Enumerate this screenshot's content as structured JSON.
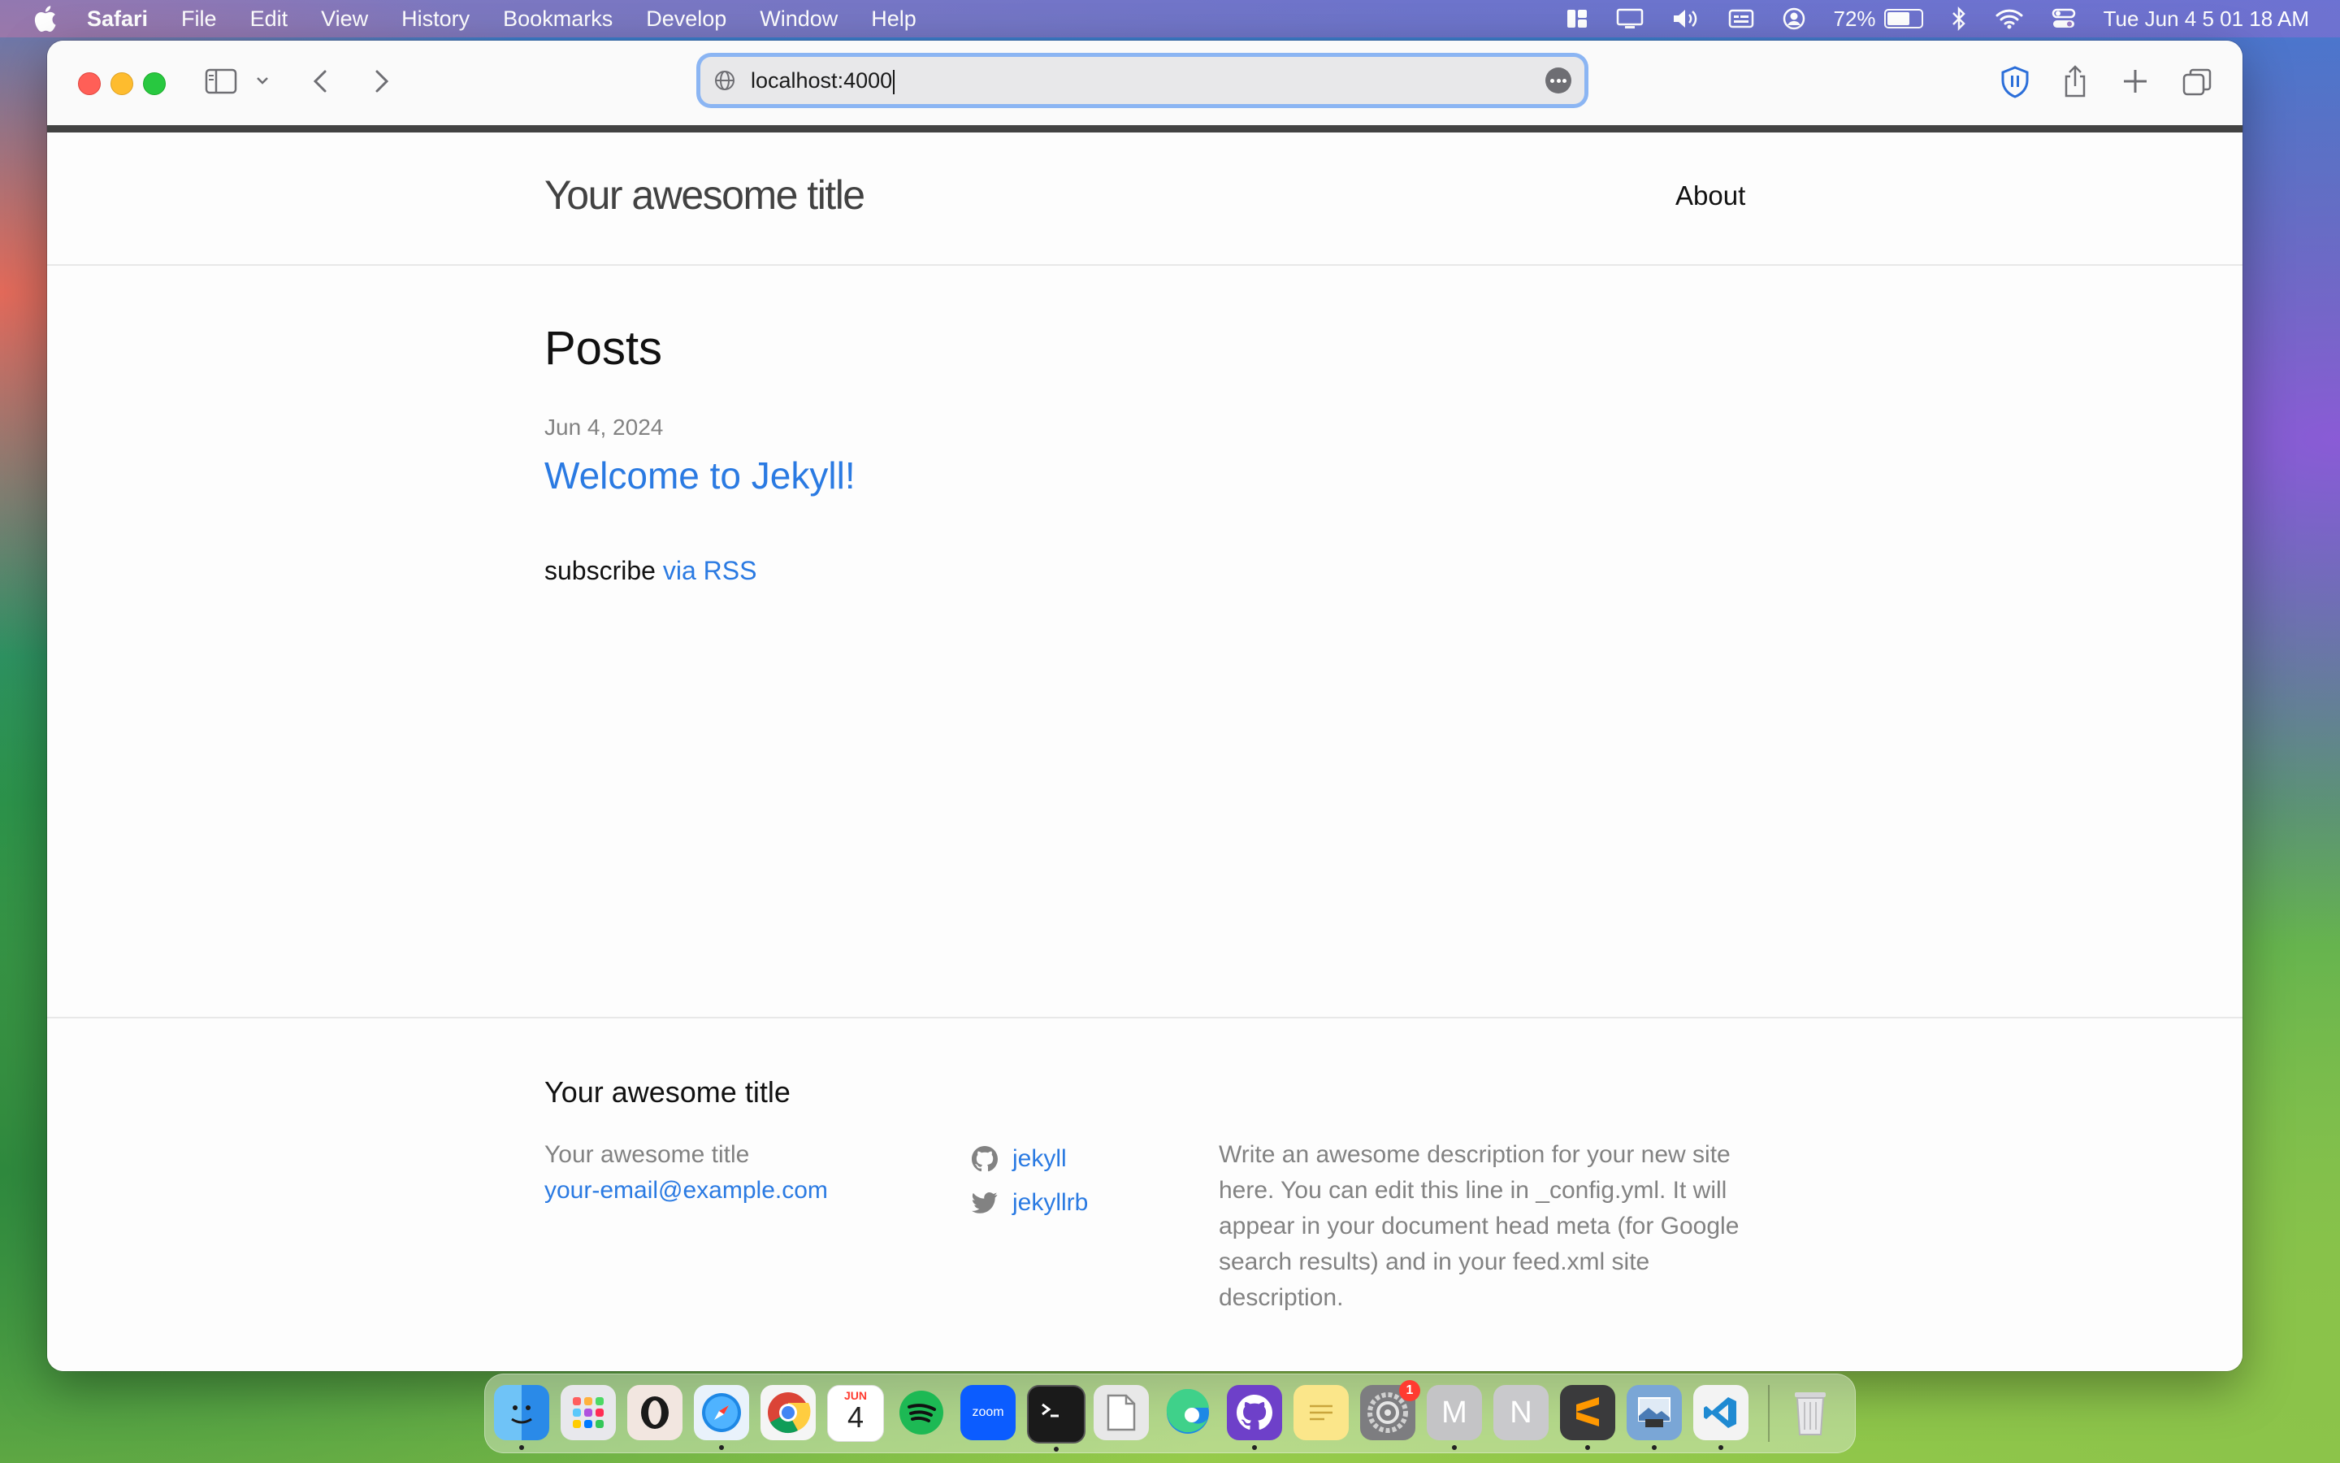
{
  "menubar": {
    "app_name": "Safari",
    "items": [
      "File",
      "Edit",
      "View",
      "History",
      "Bookmarks",
      "Develop",
      "Window",
      "Help"
    ],
    "battery_percent": "72%",
    "battery_level": 0.72,
    "datetime": "Tue Jun 4  5 01 18 AM"
  },
  "browser": {
    "url": "localhost:4000"
  },
  "site": {
    "title": "Your awesome title",
    "nav": [
      "About"
    ],
    "posts_heading": "Posts",
    "posts": [
      {
        "date": "Jun 4, 2024",
        "title": "Welcome to Jekyll!"
      }
    ],
    "subscribe_text": "subscribe",
    "subscribe_link": "via RSS",
    "footer": {
      "heading": "Your awesome title",
      "name": "Your awesome title",
      "email": "your-email@example.com",
      "github": "jekyll",
      "twitter": "jekyllrb",
      "description": "Write an awesome description for your new site here. You can edit this line in _config.yml. It will appear in your document head meta (for Google search results) and in your feed.xml site description."
    }
  },
  "dock": {
    "calendar_month": "JUN",
    "calendar_day": "4",
    "zoom_label": "zoom",
    "settings_badge": "1",
    "m_label": "M",
    "n_label": "N"
  }
}
